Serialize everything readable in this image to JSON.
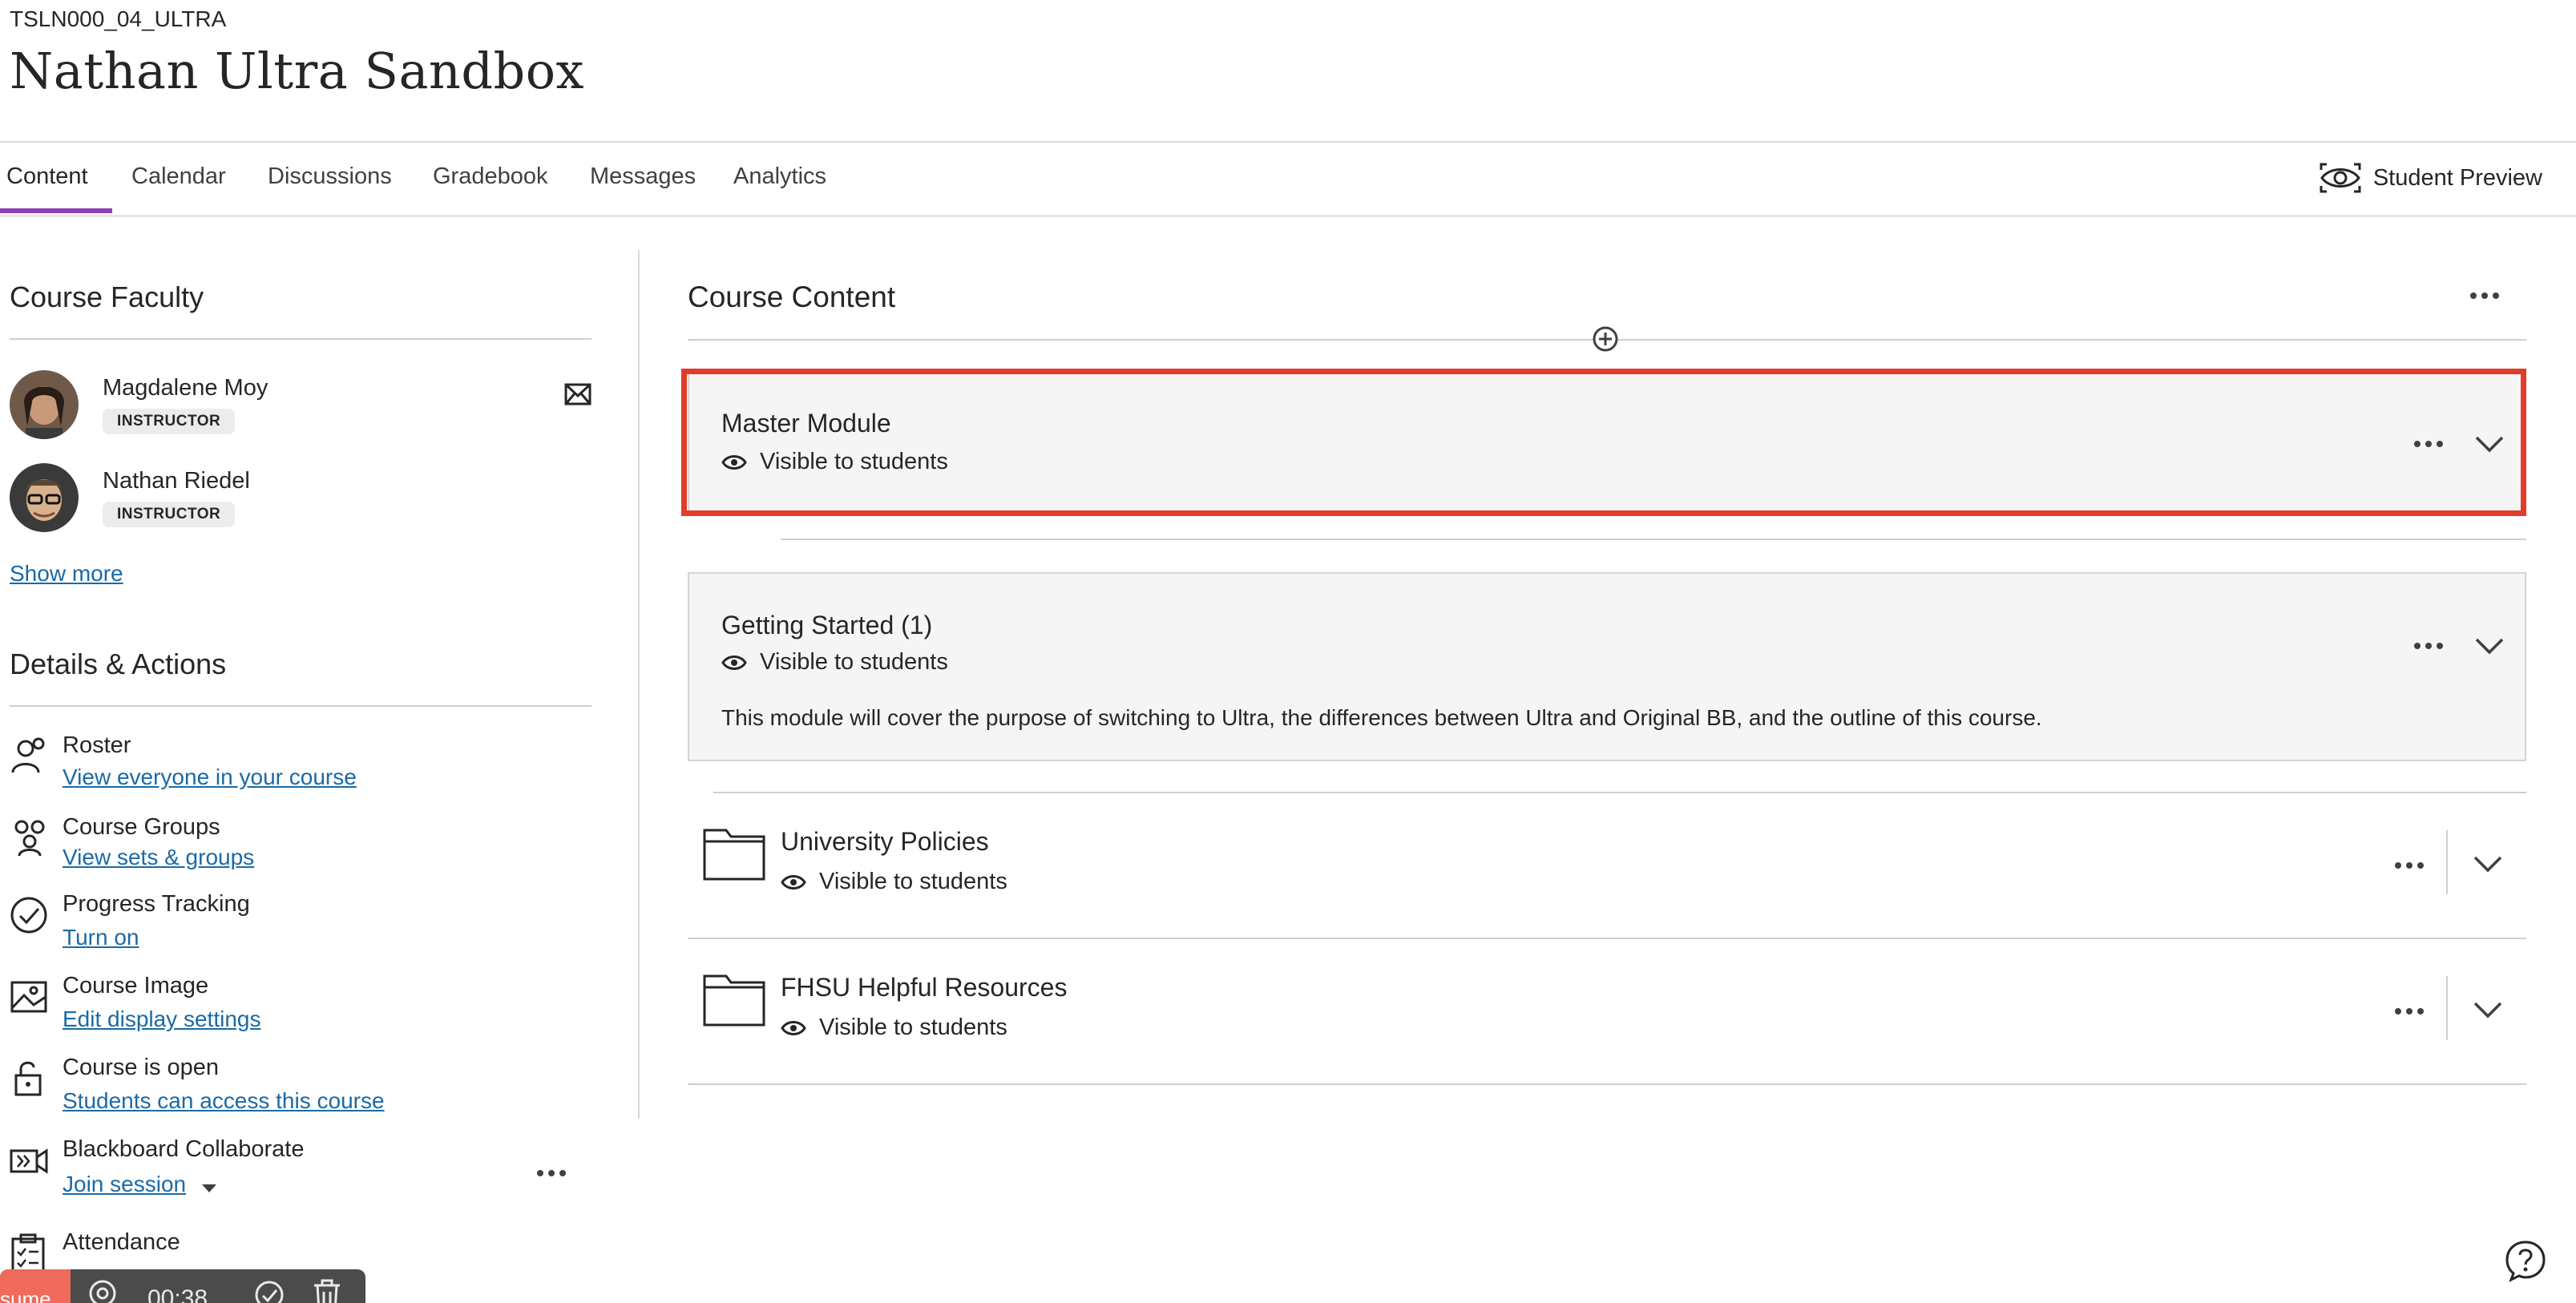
{
  "header": {
    "course_id": "TSLN000_04_ULTRA",
    "course_title": "Nathan Ultra Sandbox"
  },
  "tabs": [
    {
      "label": "Content",
      "active": true
    },
    {
      "label": "Calendar"
    },
    {
      "label": "Discussions"
    },
    {
      "label": "Gradebook"
    },
    {
      "label": "Messages"
    },
    {
      "label": "Analytics"
    }
  ],
  "student_preview": {
    "label": "Student Preview",
    "icon": "eye-preview-icon"
  },
  "faculty": {
    "title": "Course Faculty",
    "members": [
      {
        "name": "Magdalene Moy",
        "role": "INSTRUCTOR"
      },
      {
        "name": "Nathan Riedel",
        "role": "INSTRUCTOR"
      }
    ],
    "show_more": "Show more"
  },
  "details": {
    "title": "Details & Actions",
    "items": [
      {
        "label": "Roster",
        "link": "View everyone in your course",
        "icon": "roster-icon"
      },
      {
        "label": "Course Groups",
        "link": "View sets & groups",
        "icon": "groups-icon"
      },
      {
        "label": "Progress Tracking",
        "link": "Turn on",
        "icon": "check-circle-icon"
      },
      {
        "label": "Course Image",
        "link": "Edit display settings",
        "icon": "image-icon"
      },
      {
        "label": "Course is open",
        "link": "Students can access this course",
        "icon": "unlock-icon"
      },
      {
        "label": "Blackboard Collaborate",
        "link": "Join session",
        "icon": "collaborate-icon"
      },
      {
        "label": "Attendance",
        "link": "",
        "icon": "attendance-icon"
      }
    ]
  },
  "content": {
    "title": "Course Content",
    "modules": [
      {
        "title": "Master Module",
        "visibility": "Visible to students",
        "highlighted": true
      },
      {
        "title": "Getting Started (1)",
        "visibility": "Visible to students",
        "description": "This module will cover the purpose of switching to Ultra, the differences between Ultra and Original BB, and the outline of this course."
      }
    ],
    "folders": [
      {
        "title": "University Policies",
        "visibility": "Visible to students"
      },
      {
        "title": "FHSU Helpful Resources",
        "visibility": "Visible to students"
      }
    ]
  },
  "recorder": {
    "left_label": "sume",
    "time": "00:38"
  },
  "colors": {
    "accent": "#8e3fb4",
    "link": "#1a6aa6",
    "highlight": "#e23c2a"
  }
}
